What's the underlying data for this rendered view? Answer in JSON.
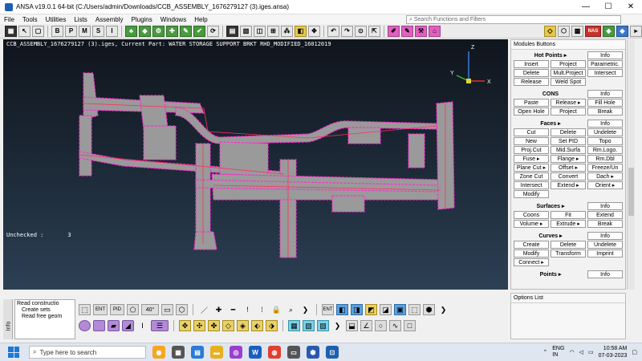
{
  "window": {
    "title": "ANSA v19.0.1 64-bit (C:/Users/admin/Downloads/CCB_ASSEMBLY_1676279127 (3).iges.ansa)",
    "controls": [
      "—",
      "☐",
      "✕"
    ]
  },
  "menu": {
    "items": [
      "File",
      "Tools",
      "Utilities",
      "Lists",
      "Assembly",
      "Plugins",
      "Windows",
      "Help"
    ],
    "search_placeholder": "Search Functions and Filters"
  },
  "toolbar": {
    "letters": [
      "B",
      "P",
      "M",
      "S",
      "I"
    ],
    "nas_label": "NAS"
  },
  "viewport": {
    "header_text": "CCB_ASSEMBLY_1676279127 (3).iges,  Current Part: WATER STORAGE SUPPORT BRKT RHD_MODIFIED_16012019",
    "status_label": "Unchecked :",
    "status_count": "3",
    "axis_labels": {
      "x": "X",
      "y": "Y",
      "z": "Z"
    },
    "colors": {
      "mesh": "#9a9a9a",
      "edges": "#ff2fd0",
      "outline": "#ff3060"
    }
  },
  "modules": {
    "title": "Modules Buttons",
    "info_label": "Info",
    "groups": [
      {
        "name": "Hot Points",
        "buttons": [
          "Insert",
          "Project",
          "Parametric.",
          "Delete",
          "Mult.Project",
          "Intersect",
          "Release",
          "Weld Spot"
        ]
      },
      {
        "name": "CONS",
        "buttons": [
          "Paste",
          "Release",
          "Fill Hole",
          "Open Hole",
          "Project",
          "Break"
        ]
      },
      {
        "name": "Faces",
        "buttons": [
          "Cut",
          "Delete",
          "Undelete",
          "New",
          "Set PID",
          "Topo",
          "Proj.Cut",
          "Mid.Surfa",
          "Rm.Logo.",
          "Fuse",
          "Flange",
          "Rm.Dbl",
          "Plane Cut",
          "Offset",
          "Freeze/Un",
          "Zone Cut",
          "Convert",
          "Dach",
          "Intersect",
          "Extend",
          "Orient",
          "Modify"
        ]
      },
      {
        "name": "Surfaces",
        "buttons": [
          "Coons",
          "Fit",
          "Extend",
          "Volume",
          "Extrude",
          "Break"
        ]
      },
      {
        "name": "Curves",
        "buttons": [
          "Create",
          "Delete",
          "Undelete",
          "Modify",
          "Transform",
          "Imprint",
          "Connect"
        ]
      },
      {
        "name": "Points",
        "buttons": []
      }
    ]
  },
  "log": {
    "lines": [
      "Read constructio",
      "Create sets",
      "Read free geom"
    ]
  },
  "info_tab": "Info",
  "bottom_tools": {
    "angle": "40°",
    "ent_label": "ENT",
    "pid_label": "PID"
  },
  "options": {
    "title": "Options List"
  },
  "taskbar": {
    "search_placeholder": "Type here to search",
    "language": "ENG\nIN",
    "time": "10:58 AM",
    "date": "07-03-2023"
  }
}
